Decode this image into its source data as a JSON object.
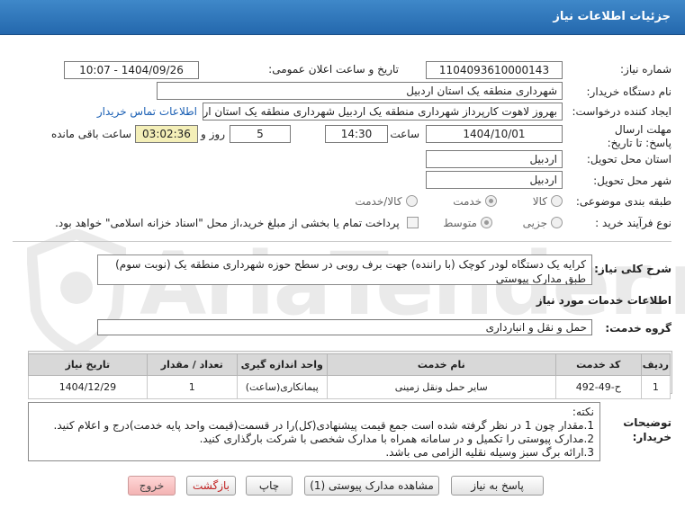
{
  "header": {
    "title": "جزئیات اطلاعات نیاز"
  },
  "form": {
    "need_number_label": "شماره نیاز:",
    "need_number": "1104093610000143",
    "announce_label": "تاریخ و ساعت اعلان عمومی:",
    "announce_value": "1404/09/26 - 10:07",
    "buyer_org_label": "نام دستگاه خریدار:",
    "buyer_org": "شهرداری منطقه یک استان اردبیل",
    "creator_label": "ایجاد کننده درخواست:",
    "creator": "بهروز لاهوت کارپرداز شهرداری منطقه یک اردبیل شهرداری منطقه یک استان اردبیل",
    "contact_link": "اطلاعات تماس خریدار",
    "deadline_label": "مهلت ارسال پاسخ: تا تاریخ:",
    "deadline_date": "1404/10/01",
    "time_label": "ساعت",
    "deadline_time": "14:30",
    "days_value": "5",
    "days_label": "روز و",
    "remaining_value": "03:02:36",
    "remaining_label": "ساعت باقی مانده",
    "province_label": "استان محل تحویل:",
    "province": "اردبیل",
    "city_label": "شهر محل تحویل:",
    "city": "اردبیل",
    "category_label": "طبقه بندی موضوعی:",
    "category_options": [
      "کالا",
      "خدمت",
      "کالا/خدمت"
    ],
    "category_selected": "خدمت",
    "purchase_type_label": "نوع فرآیند خرید :",
    "purchase_options": [
      "جزیی",
      "متوسط"
    ],
    "purchase_selected": "متوسط",
    "payment_note": "پرداخت تمام یا بخشی از مبلغ خرید،از محل \"اسناد خزانه اسلامی\" خواهد بود."
  },
  "description": {
    "label": "شرح کلی نیاز:",
    "text": "کرایه یک دستگاه لودر کوچک (با راننده) جهت برف روبی در سطح حوزه شهرداری منطقه یک (نوبت سوم) طبق مدارک پیوستی"
  },
  "services": {
    "section_title": "اطلاعات خدمات مورد نیاز",
    "group_label": "گروه خدمت:",
    "group_value": "حمل و نقل و انبارداری",
    "columns": [
      "ردیف",
      "کد خدمت",
      "نام خدمت",
      "واحد اندازه گیری",
      "تعداد / مقدار",
      "تاریخ نیاز"
    ],
    "rows": [
      {
        "index": "1",
        "code": "ح-49-492",
        "name": "سایر حمل ونقل زمینی",
        "unit": "پیمانکاری(ساعت)",
        "qty": "1",
        "date": "1404/12/29"
      }
    ]
  },
  "notes": {
    "label": "توضیحات خریدار:",
    "lines": [
      "نکته:",
      "1.مقدار چون 1 در نظر گرفته شده است جمع قیمت پیشنهادی(کل)را در قسمت(قیمت واحد پایه خدمت)درج و اعلام کنید.",
      "2.مدارک پیوستی را تکمیل و در سامانه همراه با مدارک شخصی با شرکت بارگذاری کنید.",
      "3.ارائه برگ سبز وسیله نقلیه الزامی می باشد."
    ]
  },
  "buttons": {
    "reply": "پاسخ به نیاز",
    "attachments": "مشاهده مدارک پیوستی (1)",
    "print": "چاپ",
    "back": "بازگشت",
    "exit": "خروج"
  },
  "watermark": "AriaTender.net"
}
